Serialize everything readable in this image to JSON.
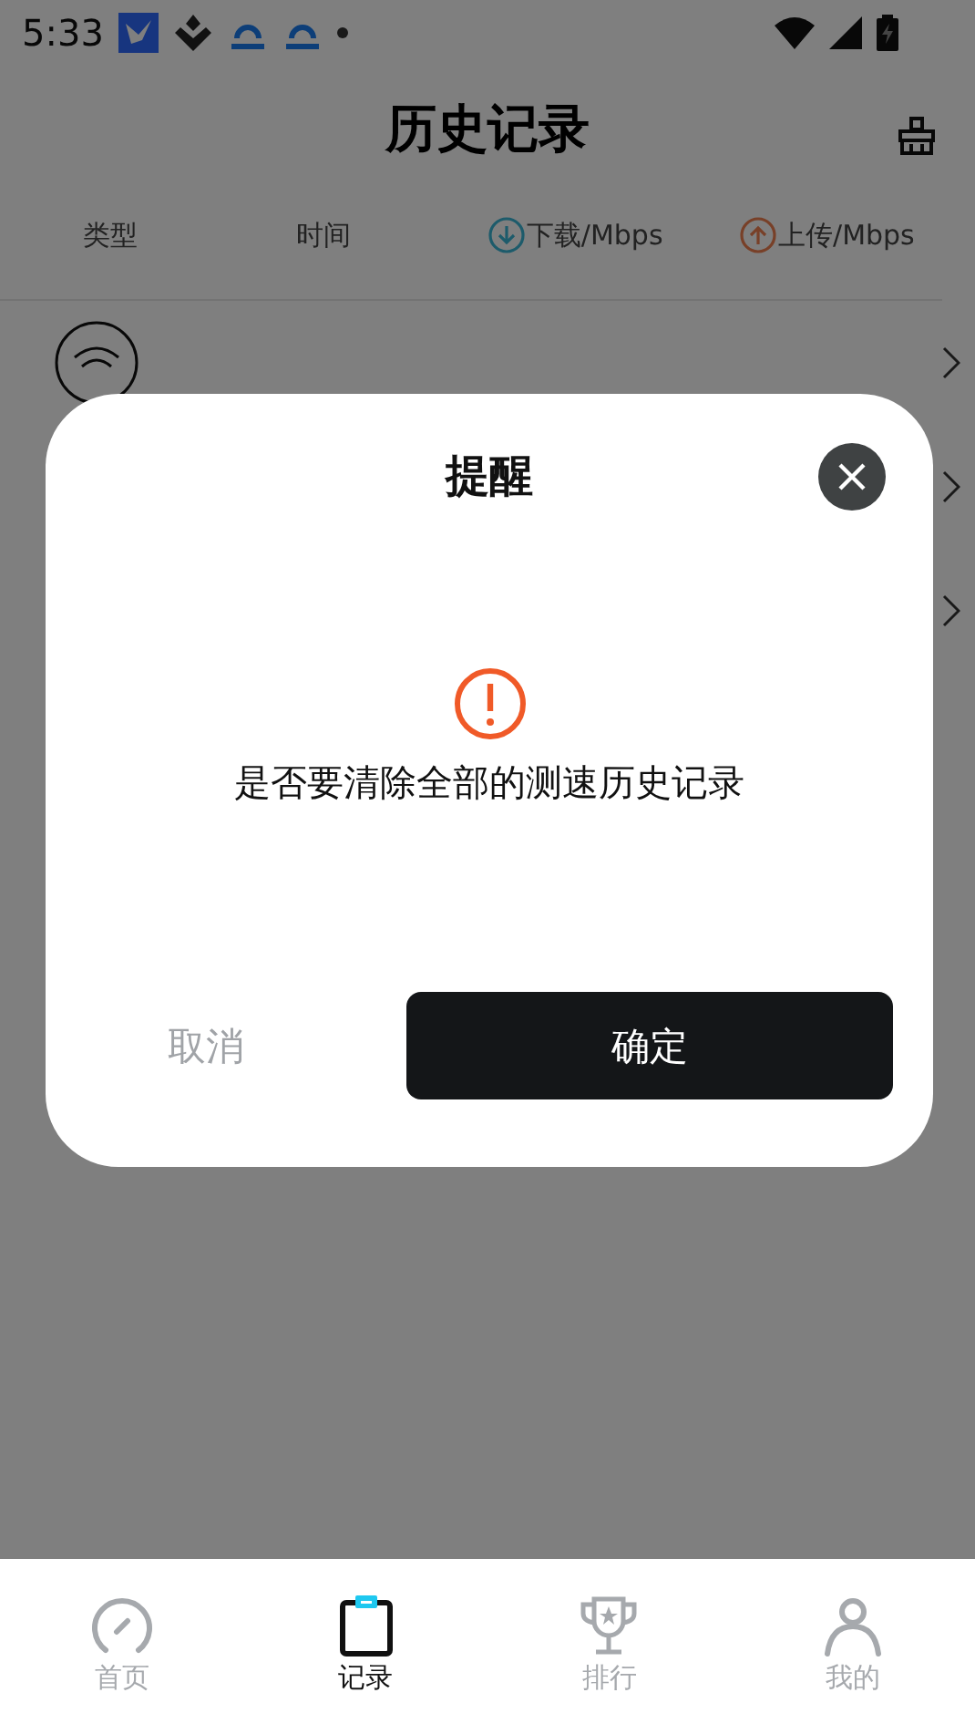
{
  "status_bar": {
    "time": "5:33"
  },
  "header": {
    "title": "历史记录"
  },
  "table": {
    "columns": [
      {
        "label": "类型",
        "kind": "plain"
      },
      {
        "label": "时间",
        "kind": "plain"
      },
      {
        "label": "下载/Mbps",
        "kind": "download"
      },
      {
        "label": "上传/Mbps",
        "kind": "upload"
      }
    ]
  },
  "dialog": {
    "title": "提醒",
    "message": "是否要清除全部的测速历史记录",
    "cancel": "取消",
    "confirm": "确定"
  },
  "tabs": [
    {
      "label": "首页",
      "kind": "gauge",
      "selected": false
    },
    {
      "label": "记录",
      "kind": "clipboard",
      "selected": true
    },
    {
      "label": "排行",
      "kind": "trophy",
      "selected": false
    },
    {
      "label": "我的",
      "kind": "person",
      "selected": false
    }
  ]
}
